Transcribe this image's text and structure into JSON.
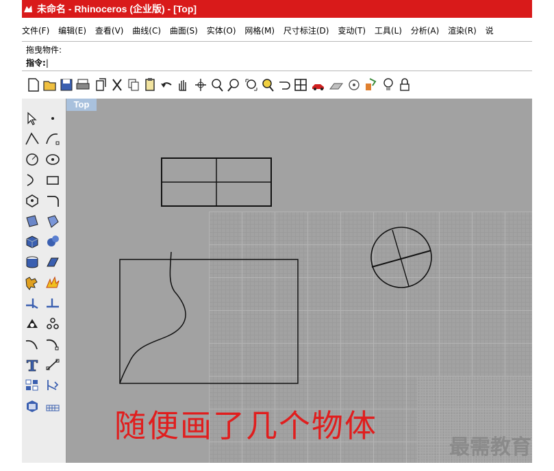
{
  "window": {
    "title": "未命名 - Rhinoceros (企业版) - [Top]"
  },
  "menu": {
    "items": [
      "文件(F)",
      "编辑(E)",
      "查看(V)",
      "曲线(C)",
      "曲面(S)",
      "实体(O)",
      "网格(M)",
      "尺寸标注(D)",
      "变动(T)",
      "工具(L)",
      "分析(A)",
      "渲染(R)",
      "说"
    ]
  },
  "command": {
    "drag_label": "拖曳物件:",
    "prompt_label": "指令:",
    "caret": "|"
  },
  "toolbar": {
    "icons": [
      "new-file-icon",
      "open-folder-icon",
      "save-icon",
      "print-icon",
      "import-icon",
      "cut-icon",
      "copy-icon",
      "paste-icon",
      "undo-icon",
      "pan-icon",
      "rotate-view-icon",
      "zoom-icon",
      "zoom-window-icon",
      "zoom-extents-icon",
      "zoom-selected-icon",
      "undo-view-icon",
      "four-viewports-icon",
      "car-render-icon",
      "ground-plane-icon",
      "osnap-icon",
      "properties-icon",
      "light-icon",
      "lock-icon"
    ]
  },
  "left_toolbar": {
    "icons": [
      "select-icon",
      "point-icon",
      "polyline-icon",
      "control-points-curve-icon",
      "circle-icon",
      "ellipse-icon",
      "arc-icon",
      "rectangle-icon",
      "polygon-icon",
      "fillet-curve-icon",
      "surface-patch-icon",
      "surface-edge-icon",
      "box-icon",
      "sphere-icon",
      "cylinder-icon",
      "extrude-icon",
      "boolean-icon",
      "explode-icon",
      "split-icon",
      "trim-icon",
      "group-icon",
      "array-icon",
      "curve-blend-icon",
      "curve-chamfer-icon",
      "text-icon",
      "dimension-icon",
      "layout-icon",
      "transform-icon",
      "render-icon",
      "grid-snap-icon"
    ]
  },
  "viewport": {
    "label": "Top",
    "caption": "随便画了几个物体"
  },
  "watermark": "最需教育",
  "colors": {
    "title_bar": "#d91a1a",
    "viewport_bg": "#a2a2a2",
    "viewport_tab": "#a9c1dd",
    "caption": "#e01e1e"
  }
}
